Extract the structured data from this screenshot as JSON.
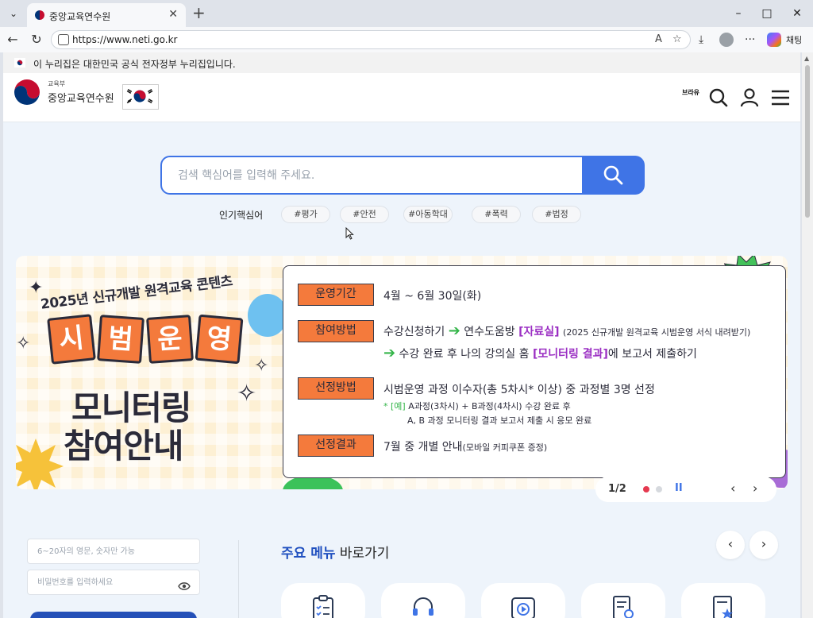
{
  "browser": {
    "tab_title": "중앙교육연수원",
    "url": "https://www.neti.go.kr",
    "copilot_label": "채팅"
  },
  "gov_banner": {
    "text": "이 누리집은 대한민국 공식 전자정부 누리집입니다."
  },
  "header": {
    "ministry": "교육부",
    "site_name": "중앙교육연수원",
    "braille_label": "브라유"
  },
  "search": {
    "placeholder": "검색 핵심어를 입력해 주세요.",
    "popular_label": "인기핵심어",
    "tags": [
      "#평가",
      "#안전",
      "#아동학대",
      "#폭력",
      "#법정"
    ]
  },
  "banner": {
    "subtitle": "2025년 신규개발 원격교육 콘텐츠",
    "tiles": [
      "시",
      "범",
      "운",
      "영"
    ],
    "big_line1": "모니터링",
    "big_line2": "참여안내",
    "rows": {
      "period_label": "운영기간",
      "period_text": "4월 ~ 6월 30일(화)",
      "method_label": "참여방법",
      "method_line1_a": "수강신청하기",
      "method_line1_b": "연수도움방",
      "method_line1_c": "[자료실]",
      "method_line1_d": "(2025 신규개발 원격교육 시범운영 서식 내려받기)",
      "method_line2_a": "수강 완료 후 나의 강의실 홈",
      "method_line2_b": "[모니터링 결과]",
      "method_line2_c": "에 보고서 제출하기",
      "select_label": "선정방법",
      "select_text": "시범운영 과정 이수자(총 5차시* 이상) 중 과정별 3명 선정",
      "select_note1_a": "* [예]",
      "select_note1_b": " A과정(3차시) + B과정(4차시) 수강 완료 후",
      "select_note2": "A, B 과정 모니터링 결과 보고서 제출 시 응모 완료",
      "result_label": "선정결과",
      "result_text_a": "7월 중 개별 안내",
      "result_text_b": "(모바일 커피쿠폰 증정)"
    },
    "pager": {
      "count": "1/2",
      "pause": "II"
    }
  },
  "login": {
    "id_placeholder": "6~20자의 영문, 숫자만 가능",
    "pw_placeholder": "비밀번호를 입력하세요"
  },
  "menu": {
    "title_strong": "주요 메뉴",
    "title_rest": " 바로가기"
  },
  "colors": {
    "accent": "#3f74e6",
    "banner_orange": "#f47a3c",
    "highlight_purple": "#9b2fc3",
    "arrow_green": "#35b54a"
  }
}
